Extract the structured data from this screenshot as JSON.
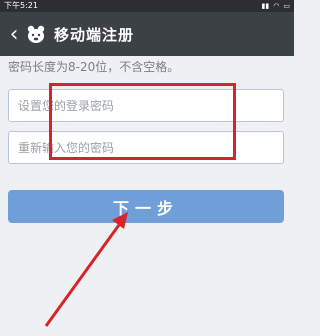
{
  "status_bar": {
    "time": "下午5:21",
    "icons": [
      "signal-icon",
      "wifi-icon",
      "battery-icon"
    ]
  },
  "header": {
    "title": "移动端注册",
    "back_icon": "chevron-left-icon",
    "logo_icon": "bear-logo"
  },
  "form": {
    "hint": "密码长度为8-20位，不含空格。",
    "password": {
      "placeholder": "设置您的登录密码",
      "value": ""
    },
    "confirm_password": {
      "placeholder": "重新输入您的密码",
      "value": ""
    },
    "next_label": "下一步"
  },
  "colors": {
    "status_bar": "#2b2f33",
    "title_bar": "#3c4146",
    "background": "#eef0f3",
    "button": "#6f9ed8",
    "annotation": "#d7242a"
  }
}
